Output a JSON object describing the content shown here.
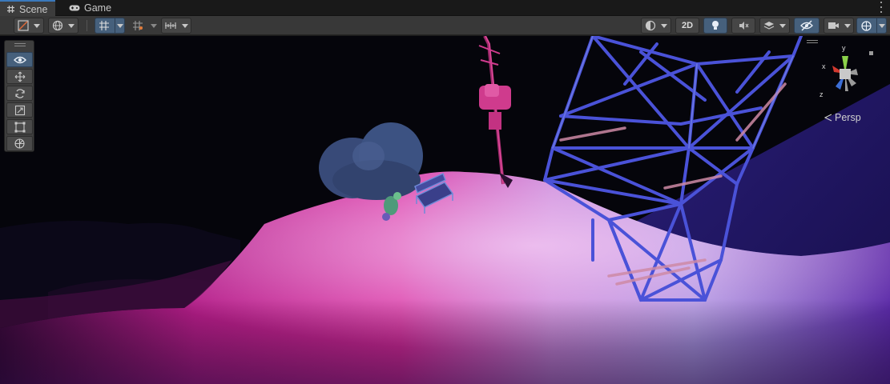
{
  "tabs": [
    {
      "label": "Scene",
      "icon": "grid-hash-icon",
      "active": true
    },
    {
      "label": "Game",
      "icon": "gamepad-icon",
      "active": false
    }
  ],
  "toolbar": {
    "draw_mode_icon": "shading-mode-icon",
    "global_icon": "globe-icon",
    "grid_snap_icon": "grid-snap-icon",
    "increment_snap_icon": "increment-snap-icon",
    "ruler_icon": "ruler-icon",
    "render_mode_icon": "render-sphere-icon",
    "two_d_label": "2D",
    "lighting_icon": "lightbulb-icon",
    "audio_icon": "audio-mute-icon",
    "effects_icon": "effects-layers-icon",
    "visibility_icon": "hidden-eye-icon",
    "camera_icon": "camera-icon",
    "gizmos_icon": "gizmo-sphere-icon"
  },
  "tools": [
    {
      "name": "view-tool",
      "icon": "eye-icon",
      "active": true
    },
    {
      "name": "move-tool",
      "icon": "move-arrows-icon",
      "active": false
    },
    {
      "name": "rotate-tool",
      "icon": "rotate-icon",
      "active": false
    },
    {
      "name": "scale-tool",
      "icon": "scale-icon",
      "active": false
    },
    {
      "name": "rect-tool",
      "icon": "rect-transform-icon",
      "active": false
    },
    {
      "name": "transform-tool",
      "icon": "transform-icon",
      "active": false
    }
  ],
  "gizmo": {
    "x_label": "x",
    "y_label": "y",
    "z_label": "z",
    "projection_label": "Persp"
  },
  "colors": {
    "accent": "#3a79bb",
    "active_button": "#46607c",
    "hill_magenta": "#d0259a",
    "hill_lavender": "#b7a2e6",
    "tower_blue": "#4a52d8",
    "sky": "#05050b"
  }
}
